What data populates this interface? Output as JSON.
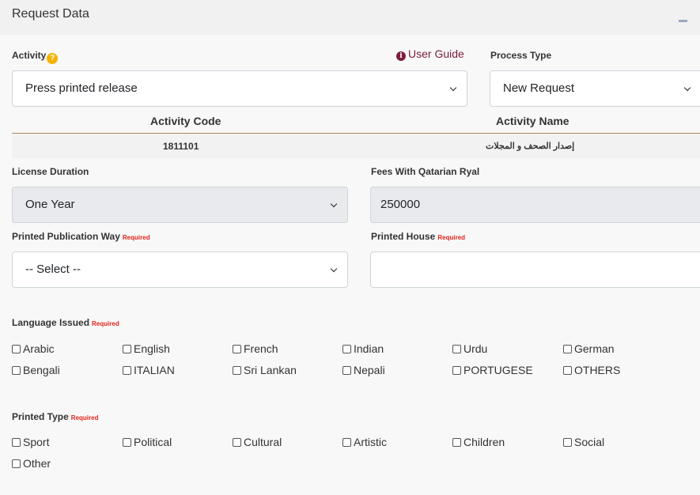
{
  "panel": {
    "title": "Request Data"
  },
  "activity": {
    "label": "Activity",
    "user_guide": "User Guide",
    "selected": "Press printed release"
  },
  "process_type": {
    "label": "Process Type",
    "selected": "New Request"
  },
  "activity_table": {
    "headers": [
      "Activity Code",
      "Activity Name"
    ],
    "row": [
      "1811101",
      "إصدار الصحف و المجلات"
    ]
  },
  "license_duration": {
    "label": "License Duration",
    "selected": "One Year"
  },
  "fees": {
    "label": "Fees With Qatarian Ryal",
    "value": "250000"
  },
  "publication_way": {
    "label": "Printed Publication Way",
    "required": "Required",
    "selected": "-- Select --"
  },
  "printed_house": {
    "label": "Printed House",
    "required": "Required",
    "value": ""
  },
  "language_issued": {
    "label": "Language Issued",
    "required": "Required",
    "options": [
      "Arabic",
      "English",
      "French",
      "Indian",
      "Urdu",
      "German",
      "Bengali",
      "ITALIAN",
      "Sri Lankan",
      "Nepali",
      "PORTUGESE",
      "OTHERS"
    ]
  },
  "printed_type": {
    "label": "Printed Type",
    "required": "Required",
    "options": [
      "Sport",
      "Political",
      "Cultural",
      "Artistic",
      "Children",
      "Social",
      "Other"
    ]
  },
  "colors": {
    "accent": "#7b1c3e",
    "required": "#e2231a",
    "help": "#f5b300",
    "table_rule": "#a88a5a"
  }
}
